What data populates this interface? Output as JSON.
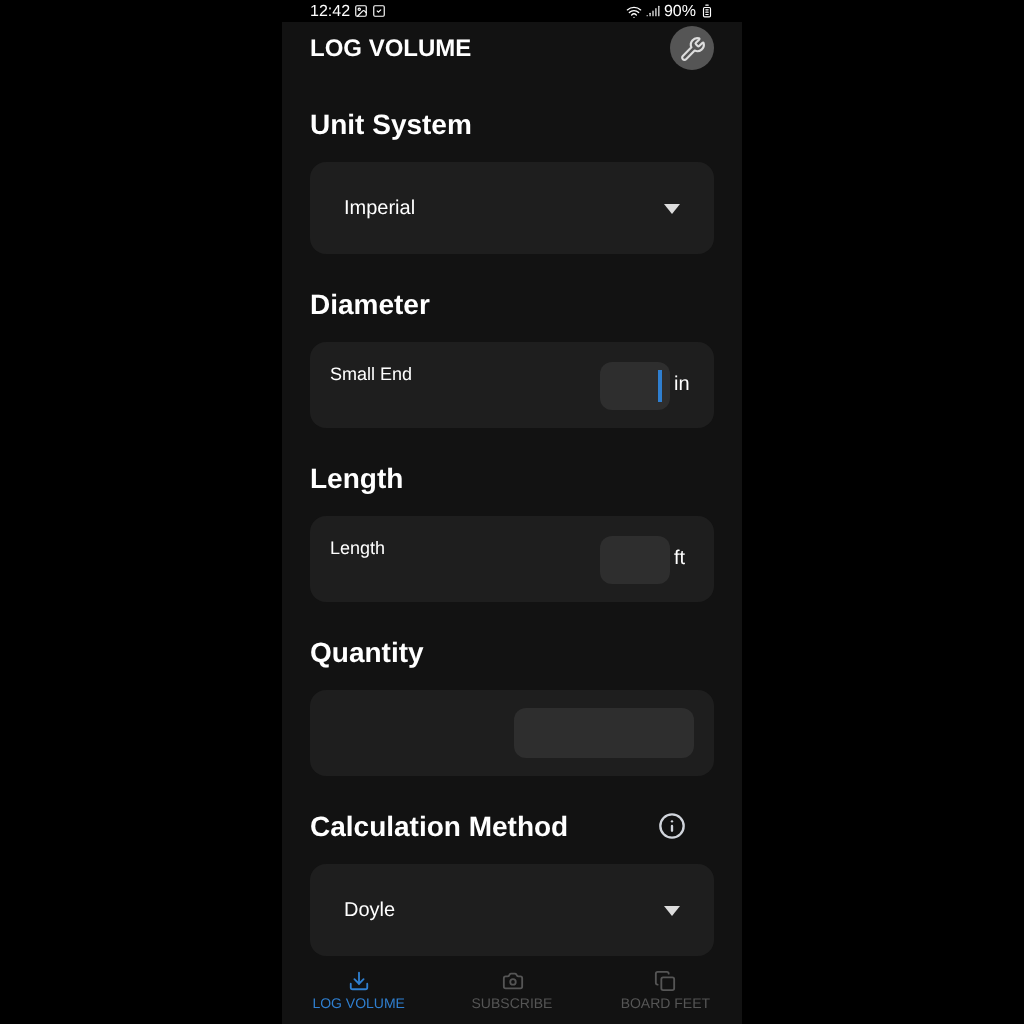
{
  "status_bar": {
    "time": "12:42",
    "battery": "90%"
  },
  "header": {
    "title": "LOG VOLUME"
  },
  "sections": [
    {
      "kind": "select",
      "heading": "Unit System",
      "value": "Imperial",
      "info": false
    },
    {
      "kind": "field",
      "heading": "Diameter",
      "label": "Small End",
      "unit": "in",
      "focused": true
    },
    {
      "kind": "field",
      "heading": "Length",
      "label": "Length",
      "unit": "ft",
      "focused": false
    },
    {
      "kind": "wide",
      "heading": "Quantity"
    },
    {
      "kind": "select",
      "heading": "Calculation Method",
      "value": "Doyle",
      "info": true
    }
  ],
  "nav": [
    {
      "label": "LOG VOLUME",
      "kind": "download",
      "selected": true
    },
    {
      "label": "SUBSCRIBE",
      "kind": "camera",
      "selected": false
    },
    {
      "label": "BOARD FEET",
      "kind": "stack",
      "selected": false
    }
  ]
}
